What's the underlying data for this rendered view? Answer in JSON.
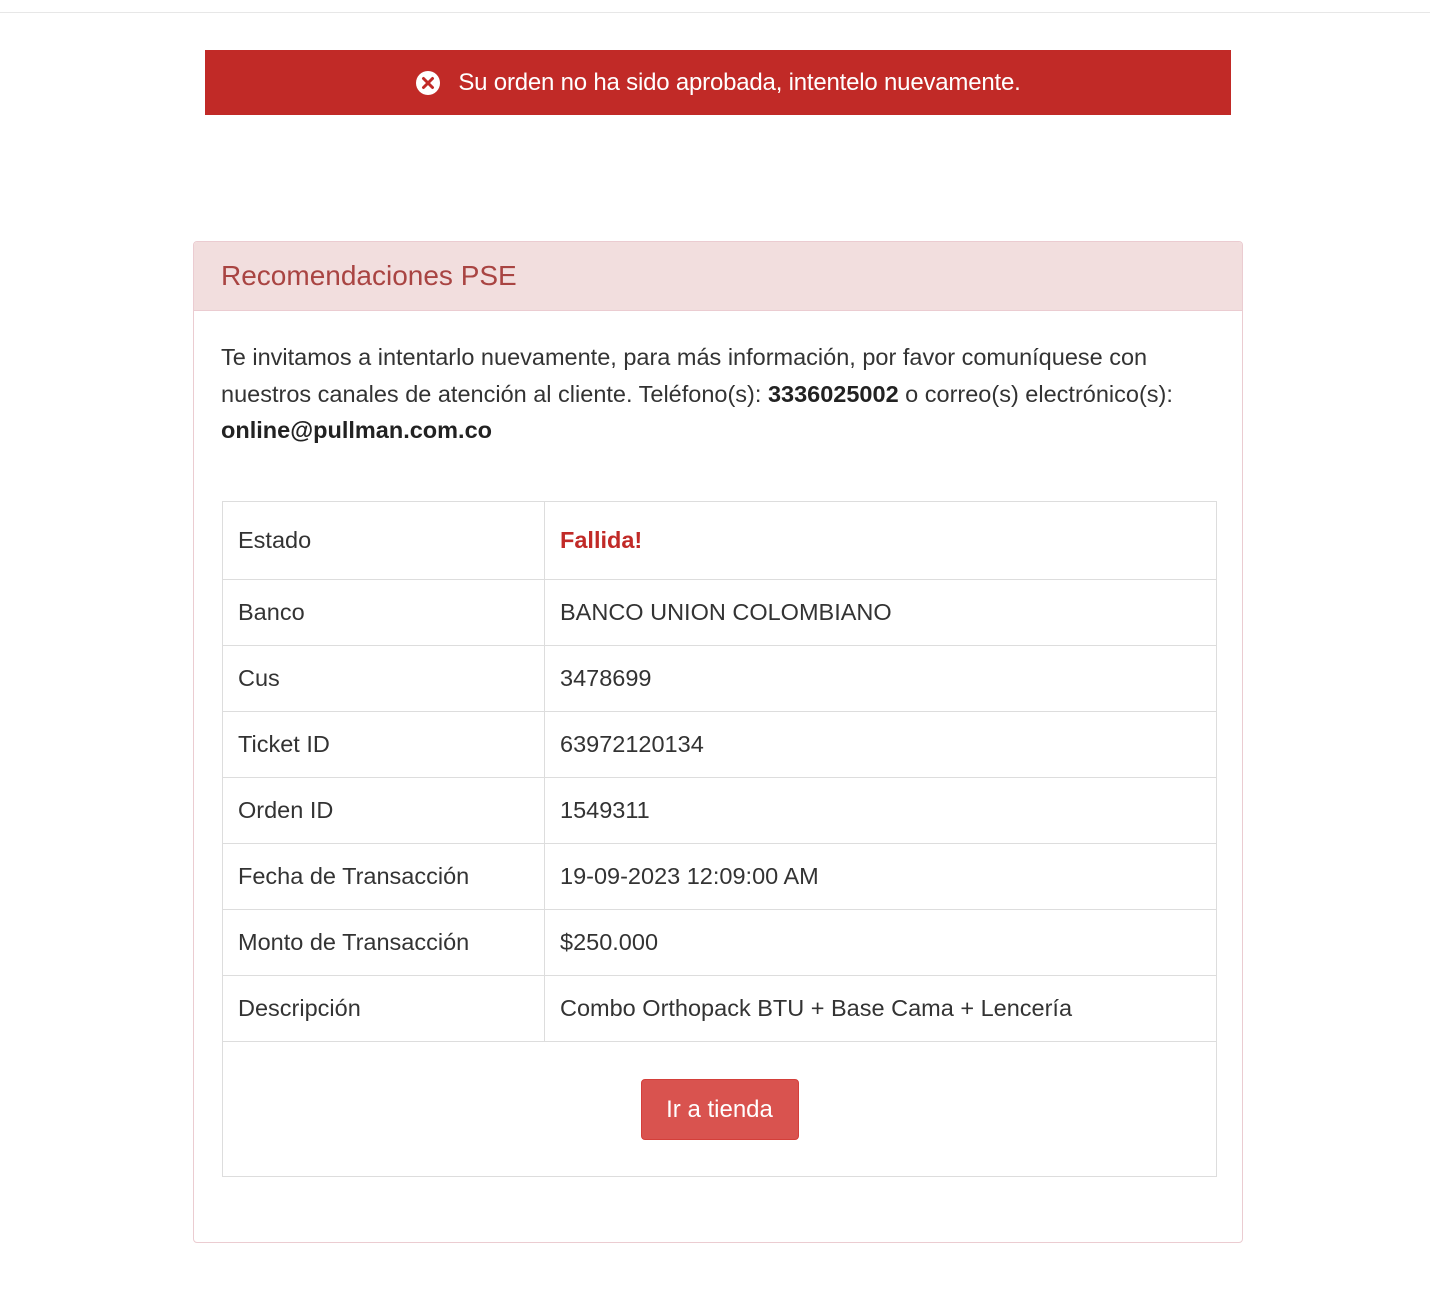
{
  "alert": {
    "icon": "error-circle-icon",
    "message": "Su orden no ha sido aprobada, intentelo nuevamente.",
    "color": "#c12a27"
  },
  "panel": {
    "title": "Recomendaciones PSE",
    "intro_text": "Te invitamos a intentarlo nuevamente, para más información, por favor comuníquese con nuestros canales de atención al cliente. Teléfono(s): ",
    "phone": "3336025002",
    "intro_mid": " o correo(s) electrónico(s): ",
    "email": "online@pullman.com.co"
  },
  "details": {
    "rows": [
      {
        "label": "Estado",
        "value": "Fallida!"
      },
      {
        "label": "Banco",
        "value": "BANCO UNION COLOMBIANO"
      },
      {
        "label": "Cus",
        "value": "3478699"
      },
      {
        "label": "Ticket ID",
        "value": "63972120134"
      },
      {
        "label": "Orden ID",
        "value": "1549311"
      },
      {
        "label": "Fecha de Transacción",
        "value": "19-09-2023 12:09:00 AM"
      },
      {
        "label": "Monto de Transacción",
        "value": "$250.000"
      },
      {
        "label": "Descripción",
        "value": "Combo Orthopack BTU + Base Cama + Lencería"
      }
    ],
    "button_label": "Ir a tienda"
  }
}
